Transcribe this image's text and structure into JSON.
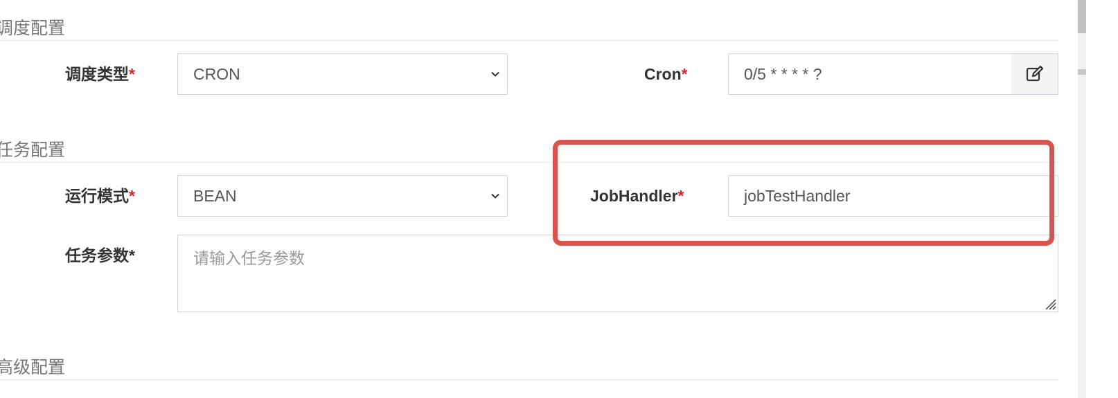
{
  "sections": {
    "schedule": "调度配置",
    "task": "任务配置",
    "advanced": "高级配置"
  },
  "schedule_type": {
    "label": "调度类型",
    "required_mark": "*",
    "value": "CRON"
  },
  "cron": {
    "label": "Cron",
    "required_mark": "*",
    "value": "0/5 * * * * ?",
    "edit_icon": "edit-icon"
  },
  "run_mode": {
    "label": "运行模式",
    "required_mark": "*",
    "value": "BEAN"
  },
  "job_handler": {
    "label": "JobHandler",
    "required_mark": "*",
    "value": "jobTestHandler"
  },
  "task_params": {
    "label": "任务参数",
    "required_mark": "*",
    "placeholder": "请输入任务参数"
  },
  "colors": {
    "required": "#d9232d",
    "highlight": "#d9534f",
    "border": "#d2d6de"
  }
}
